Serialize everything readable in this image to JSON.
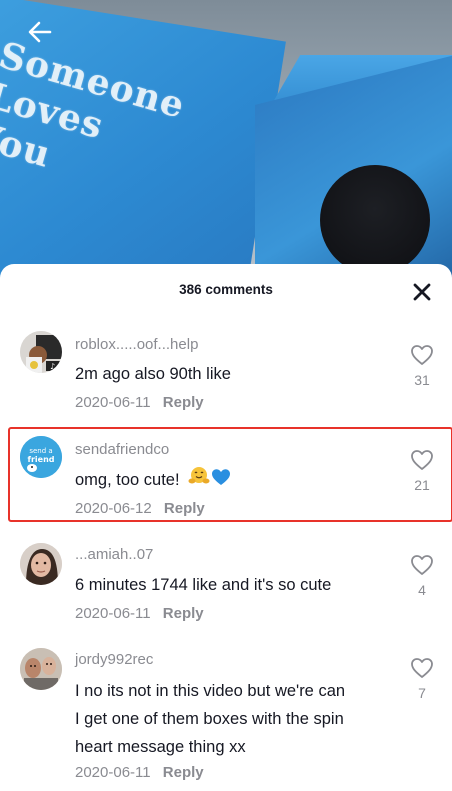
{
  "header": {
    "comments_count": "386 comments"
  },
  "comments": [
    {
      "username": "roblox.....oof...help",
      "text": "2m ago also 90th like",
      "date": "2020-06-11",
      "reply_label": "Reply",
      "likes": "31"
    },
    {
      "username": "sendafriendco",
      "text": "omg, too cute!",
      "date": "2020-06-12",
      "reply_label": "Reply",
      "likes": "21",
      "avatar_text_line1": "send a",
      "avatar_text_line2": "friend"
    },
    {
      "username": "...amiah..07",
      "text": "6 minutes 1744 like and it's so cute",
      "date": "2020-06-11",
      "reply_label": "Reply",
      "likes": "4"
    },
    {
      "username": "jordy992rec",
      "text_lines": [
        "I no its not in this video but we're can",
        "I get one of them boxes with the spin",
        "heart message thing xx"
      ],
      "date": "2020-06-11",
      "reply_label": "Reply",
      "likes": "7"
    }
  ],
  "video": {
    "box_text_lines": [
      "Someone",
      "Loves",
      "You"
    ]
  },
  "colors": {
    "highlight": "#e8332a",
    "box_blue": "#3fa1e0"
  },
  "icons": [
    "back-arrow-icon",
    "close-icon",
    "heart-outline-icon",
    "hugging-face-emoji",
    "blue-heart-emoji"
  ]
}
